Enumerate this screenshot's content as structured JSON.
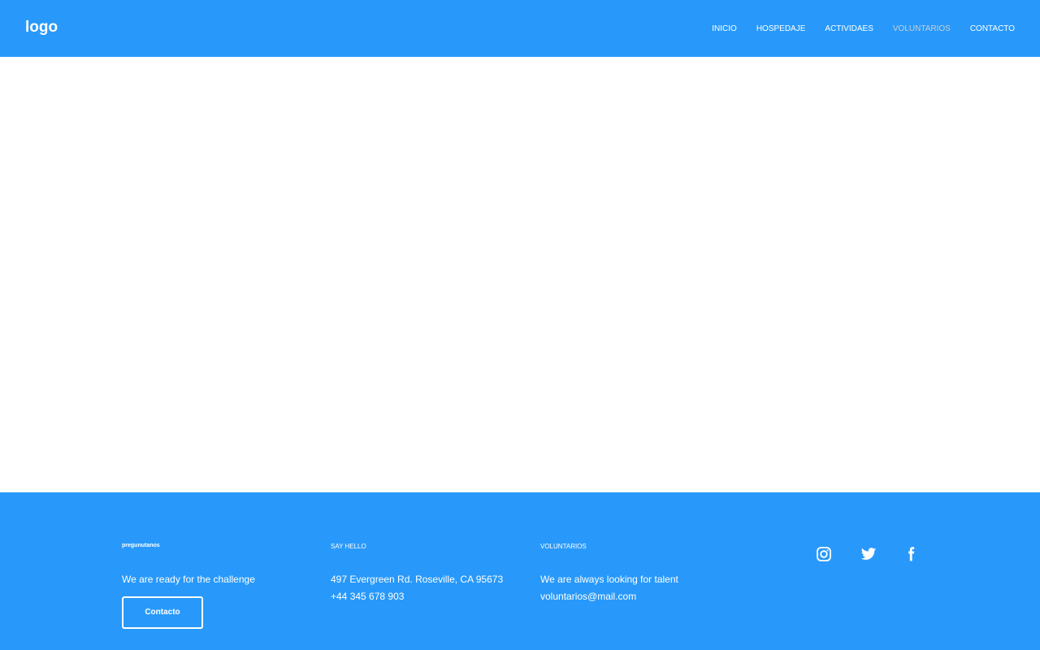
{
  "header": {
    "logo": "logo",
    "nav": [
      "INICIO",
      "HOSPEDAJE",
      "ACTIVIDAES",
      "VOLUNTARIOS",
      "CONTACTO"
    ],
    "active_index": 3
  },
  "footer": {
    "col1": {
      "heading": "pregunutanos",
      "text": "We are ready for the challenge",
      "button": "Contacto"
    },
    "col2": {
      "heading": "SAY HELLO",
      "address": "497 Evergreen Rd. Roseville, CA 95673",
      "phone": "+44 345 678 903"
    },
    "col3": {
      "heading": "VOLUNTARIOS",
      "text": "We are always looking for talent",
      "email": "voluntarios@mail.com"
    },
    "social": [
      "instagram-icon",
      "twitter-icon",
      "facebook-icon"
    ]
  },
  "colors": {
    "brand": "#2899fb"
  }
}
